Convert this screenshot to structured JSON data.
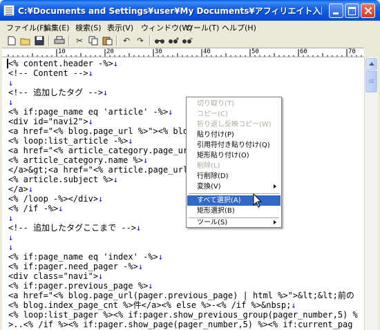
{
  "window": {
    "title": "C:¥Documents and Settings¥user¥My Documents¥アフィリエイト入門¥tmp¥記事の..."
  },
  "menubar": {
    "items": [
      "ファイル(F)",
      "編集(E)",
      "検索(S)",
      "表示(V)",
      "ウィンドウ(W)",
      "ツール(T)",
      "ヘルプ(H)"
    ]
  },
  "toolbar": {
    "icons": [
      "new-file-icon",
      "open-folder-icon",
      "save-icon",
      "print-icon",
      "cut-icon",
      "copy-icon",
      "paste-icon",
      "undo-icon",
      "redo-icon",
      "find-icon",
      "find-next-icon",
      "find-prev-icon"
    ]
  },
  "ruler": {
    "labels": [
      "10",
      "20",
      "30",
      "40",
      "50",
      "60",
      "70"
    ]
  },
  "editor": {
    "lines": [
      "<% content.header -%>↓",
      "<!-- Content -->↓",
      "↓",
      "<!-- 追加したタグ -->↓",
      "↓",
      "<% if:page_name eq 'article' -%>↓",
      "<div id=\"navi2\">↓",
      "<a href=\"<% blog.page_url %>\"><% blog",
      "<% loop:list_article -%>↓",
      "<a href=\"<% article_category.page_url",
      "<% article_category.name %>↓",
      "</a>&gt;<a href=\"<% article.page_url %",
      "<% article.subject %>↓",
      "</a>↓",
      "<% /loop -%></div>↓",
      "<% /if -%>↓",
      "↓",
      "<!-- 追加したタグここまで -->↓",
      "↓",
      "↓",
      "<% if:page_name eq 'index' -%>↓",
      "<% if:pager.need_pager -%>↓",
      "<div class=\"navi\">↓",
      "<% if:pager.previous_page %>↓",
      "<a href=\"<% blog.page_url(pager.previous_page) | html %>\">&lt;&lt;前の",
      "<% blog.index_page_cnt %>件</a><% else %>-<% /if %>&nbsp;↓",
      "<% loop:list_pager %><% if:pager.show_previous_group(pager_number,5) %",
      ">..<% /if %><% if:pager.show_page(pager_number,5) %><% if:current_pag"
    ]
  },
  "context_menu": {
    "items": [
      {
        "label": "切り取り(T)",
        "state": "disabled"
      },
      {
        "label": "コピー(C)",
        "state": "disabled"
      },
      {
        "label": "折り返し反映コピー(W)",
        "state": "disabled"
      },
      {
        "label": "貼り付け(P)",
        "state": "enabled"
      },
      {
        "label": "引用符付き貼り付け(Q)",
        "state": "enabled"
      },
      {
        "label": "矩形貼り付け(O)",
        "state": "enabled"
      },
      {
        "label": "削除(L)",
        "state": "disabled"
      },
      {
        "label": "行削除(D)",
        "state": "enabled"
      },
      {
        "label": "変換(V)",
        "state": "enabled",
        "submenu": true
      },
      {
        "label": "すべて選択(A)",
        "state": "highlighted"
      },
      {
        "label": "矩形選択(B)",
        "state": "enabled"
      },
      {
        "label": "ツール(S)",
        "state": "enabled",
        "submenu": true
      }
    ]
  },
  "colors": {
    "title_bar": "#0A5FE0",
    "highlight": "#316AC5",
    "line_feed_mark": "#0000C0",
    "disabled_text": "#ACA899"
  }
}
